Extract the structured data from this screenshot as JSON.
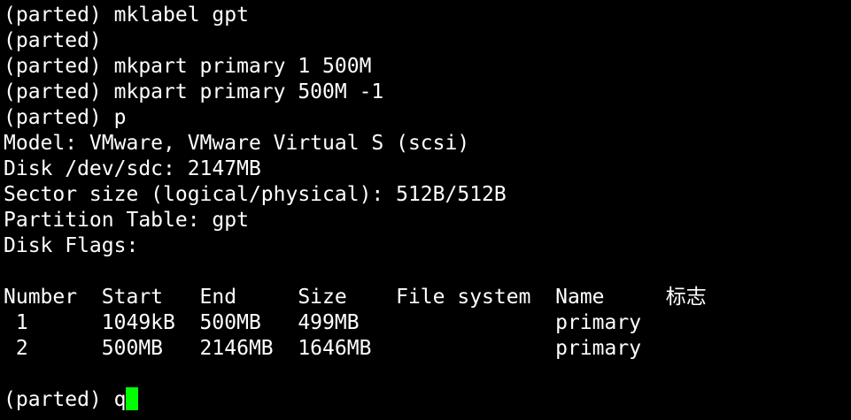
{
  "colors": {
    "background": "#000000",
    "foreground": "#ffffff",
    "cursor": "#00ff00"
  },
  "lines": [
    "(parted) mklabel gpt",
    "(parted)",
    "(parted) mkpart primary 1 500M",
    "(parted) mkpart primary 500M -1",
    "(parted) p",
    "Model: VMware, VMware Virtual S (scsi)",
    "Disk /dev/sdc: 2147MB",
    "Sector size (logical/physical): 512B/512B",
    "Partition Table: gpt",
    "Disk Flags:",
    ""
  ],
  "table": {
    "header": "Number  Start   End     Size    File system  Name     ",
    "flags_header": "标志",
    "rows": [
      " 1      1049kB  500MB   499MB                primary",
      " 2      500MB   2146MB  1646MB               primary"
    ]
  },
  "blank_after_table": "",
  "prompt": {
    "text": "(parted) ",
    "typed": "q"
  }
}
